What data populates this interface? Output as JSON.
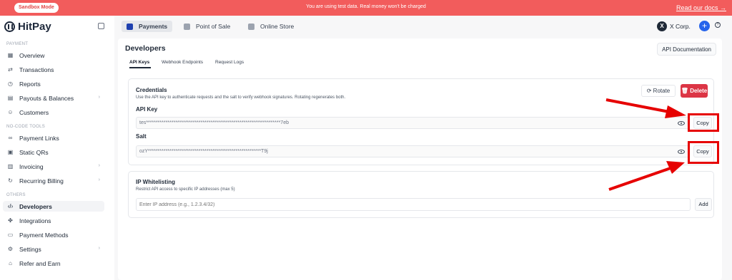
{
  "banner": {
    "sandbox": "Sandbox Mode",
    "message": "You are using test data. Real money won't be charged",
    "docs_link": "Read our docs →"
  },
  "brand": {
    "name": "HitPay"
  },
  "sidebar": {
    "section_payment": "PAYMENT",
    "section_nocode": "NO-CODE TOOLS",
    "section_others": "OTHERS",
    "items": [
      {
        "label": "Overview",
        "icon": "grid-icon"
      },
      {
        "label": "Transactions",
        "icon": "swap-icon"
      },
      {
        "label": "Reports",
        "icon": "clock-icon"
      },
      {
        "label": "Payouts & Balances",
        "icon": "doc-icon",
        "chevron": "›"
      },
      {
        "label": "Customers",
        "icon": "users-icon"
      },
      {
        "label": "Payment Links",
        "icon": "link-icon"
      },
      {
        "label": "Static QRs",
        "icon": "qr-icon"
      },
      {
        "label": "Invoicing",
        "icon": "invoice-icon",
        "chevron": "›"
      },
      {
        "label": "Recurring Billing",
        "icon": "repeat-icon",
        "chevron": "›"
      },
      {
        "label": "Developers",
        "icon": "code-icon"
      },
      {
        "label": "Integrations",
        "icon": "puzzle-icon"
      },
      {
        "label": "Payment Methods",
        "icon": "card-icon"
      },
      {
        "label": "Settings",
        "icon": "gear-icon",
        "chevron": "›"
      },
      {
        "label": "Refer and Earn",
        "icon": "gift-icon"
      }
    ]
  },
  "topbar": {
    "tabs": [
      "Payments",
      "Point of Sale",
      "Online Store"
    ],
    "account": "X Corp.",
    "account_initial": "X"
  },
  "page": {
    "title": "Developers",
    "api_doc_button": "API Documentation",
    "subtabs": [
      "API Keys",
      "Webhook Endpoints",
      "Request Logs"
    ]
  },
  "credentials": {
    "title": "Credentials",
    "description": "Use the API key to authenticate requests and the salt to verify webhook signatures. Rotating regenerates both.",
    "rotate": "Rotate",
    "delete": "Delete",
    "api_key_label": "API Key",
    "api_key_value": "tes*********************************************************************7eb",
    "salt_label": "Salt",
    "salt_value": "ozY**********************************************************T9j",
    "copy": "Copy"
  },
  "whitelist": {
    "title": "IP Whitelisting",
    "description": "Restrict API access to specific IP addresses (max 5)",
    "placeholder": "Enter IP address (e.g., 1.2.3.4/32)",
    "add": "Add"
  },
  "colors": {
    "banner": "#f25c5c",
    "brand_blue": "#2563eb",
    "delete_red": "#dc3545",
    "annotation_red": "#e60000"
  }
}
